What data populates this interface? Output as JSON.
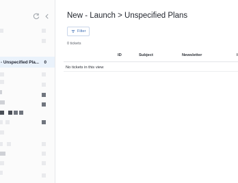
{
  "sidebar": {
    "active_view": {
      "label": "- Unspecified Pla...",
      "count": "0"
    },
    "icons": [
      "refresh-icon",
      "chevron-left-icon"
    ]
  },
  "main": {
    "title": "New - Launch > Unspecified Plans",
    "filter_label": "Filter",
    "ticket_count": "0 tickets",
    "columns": [
      "ID",
      "Subject",
      "Newsletter",
      "I"
    ],
    "empty_text": "No tickets in this view"
  }
}
